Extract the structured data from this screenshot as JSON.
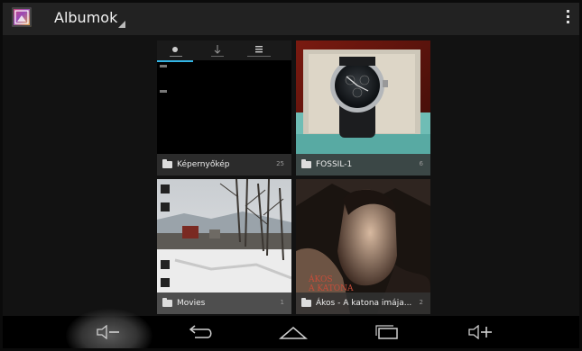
{
  "action_bar": {
    "title": "Albumok",
    "app_icon": "gallery-icon",
    "overflow_icon": "overflow-menu-icon"
  },
  "albums": [
    {
      "name": "Képernyőkép",
      "count": "25"
    },
    {
      "name": "FOSSIL-1",
      "count": "6"
    },
    {
      "name": "Movies",
      "count": "1"
    },
    {
      "name": "Ákos - A katona imája...",
      "count": "2"
    }
  ],
  "thumbnail_text": {
    "akos_title": "ÁKOS",
    "akos_subtitle": "A KATONA"
  },
  "nav_bar": {
    "icons": [
      "volume-down-icon",
      "back-icon",
      "home-icon",
      "recent-apps-icon",
      "volume-up-icon"
    ]
  },
  "colors": {
    "action_bar": "#222222",
    "accent": "#33b5e5",
    "nav_bar": "#000000"
  }
}
